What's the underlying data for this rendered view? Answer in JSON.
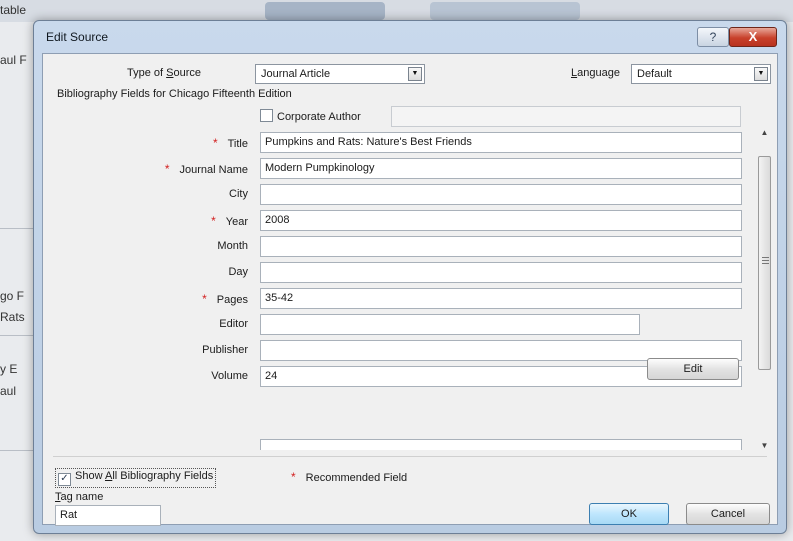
{
  "background": {
    "top_fragment": "table",
    "fragments": [
      "aul F",
      "go F",
      "Rats",
      "y E",
      "aul"
    ]
  },
  "dialog": {
    "title": "Edit Source",
    "close_label": "X",
    "help_label": "?",
    "type_of_source_label_pre": "Type of ",
    "type_of_source_label_u": "S",
    "type_of_source_label_post": "ource",
    "type_of_source_value": "Journal Article",
    "language_label_u": "L",
    "language_label_post": "anguage",
    "language_value": "Default",
    "bibliography_heading": "Bibliography Fields for Chicago Fifteenth Edition",
    "corporate_author_label": "Corporate Author",
    "corporate_author_checked": false,
    "fields": [
      {
        "label": "Title",
        "value": "Pumpkins and Rats: Nature's Best Friends",
        "recommended": true
      },
      {
        "label": "Journal Name",
        "value": "Modern Pumpkinology",
        "recommended": true
      },
      {
        "label": "City",
        "value": "",
        "recommended": false
      },
      {
        "label": "Year",
        "value": "2008",
        "recommended": true
      },
      {
        "label": "Month",
        "value": "",
        "recommended": false
      },
      {
        "label": "Day",
        "value": "",
        "recommended": false
      },
      {
        "label": "Pages",
        "value": "35-42",
        "recommended": true
      },
      {
        "label": "Editor",
        "value": "",
        "recommended": false
      },
      {
        "label": "Publisher",
        "value": "",
        "recommended": false
      },
      {
        "label": "Volume",
        "value": "24",
        "recommended": false
      }
    ],
    "editor_edit_label": "Edit",
    "show_all_label_pre": "Show ",
    "show_all_label_u": "A",
    "show_all_label_post": "ll Bibliography Fields",
    "show_all_checked": true,
    "recommended_legend": "Recommended Field",
    "tag_name_label_u": "T",
    "tag_name_label_post": "ag name",
    "tag_name_value": "Rat",
    "ok_label": "OK",
    "cancel_label": "Cancel",
    "star": "*",
    "colors": {
      "accent": "#3c7fb1",
      "star": "#d21f1f",
      "close": "#c8412b"
    }
  }
}
